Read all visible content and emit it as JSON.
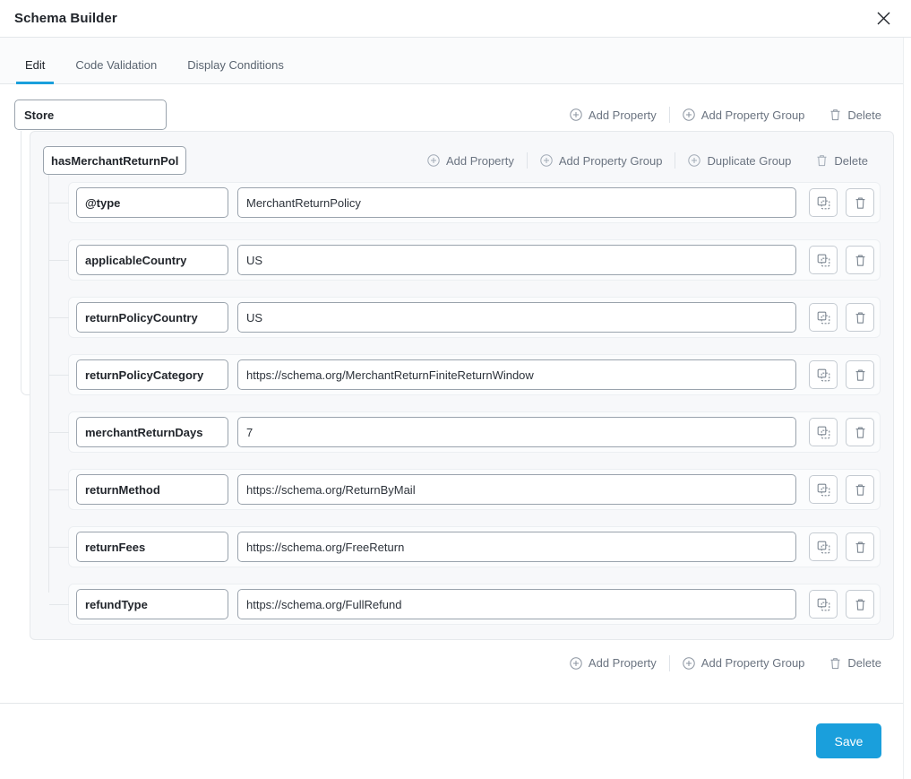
{
  "window": {
    "title": "Schema Builder",
    "close_icon": "close-icon"
  },
  "tabs": [
    {
      "label": "Edit",
      "active": true
    },
    {
      "label": "Code Validation",
      "active": false
    },
    {
      "label": "Display Conditions",
      "active": false
    }
  ],
  "root": {
    "name_value": "Store",
    "name_placeholder": "Name",
    "toolbar": {
      "add_property": "Add Property",
      "add_property_group": "Add Property Group",
      "delete": "Delete",
      "add_icon": "plus-circle-icon",
      "delete_icon": "trash-icon"
    }
  },
  "group": {
    "name_value": "hasMerchantReturnPolicy",
    "name_placeholder": "Group name",
    "toolbar": {
      "add_property": "Add Property",
      "add_property_group": "Add Property Group",
      "duplicate_group": "Duplicate Group",
      "delete": "Delete",
      "add_icon": "plus-circle-icon",
      "duplicate_icon": "plus-circle-icon",
      "delete_icon": "trash-icon"
    },
    "properties": [
      {
        "key": "@type",
        "value": "MerchantReturnPolicy"
      },
      {
        "key": "applicableCountry",
        "value": "US"
      },
      {
        "key": "returnPolicyCountry",
        "value": "US"
      },
      {
        "key": "returnPolicyCategory",
        "value": "https://schema.org/MerchantReturnFiniteReturnWindow"
      },
      {
        "key": "merchantReturnDays",
        "value": "7"
      },
      {
        "key": "returnMethod",
        "value": "https://schema.org/ReturnByMail"
      },
      {
        "key": "returnFees",
        "value": "https://schema.org/FreeReturn"
      },
      {
        "key": "refundType",
        "value": "https://schema.org/FullRefund"
      }
    ],
    "row_actions": {
      "duplicate_icon": "copy-icon",
      "delete_icon": "trash-icon"
    }
  },
  "bottom_toolbar": {
    "add_property": "Add Property",
    "add_property_group": "Add Property Group",
    "delete": "Delete",
    "add_icon": "plus-circle-icon",
    "delete_icon": "trash-icon"
  },
  "footer": {
    "save_label": "Save"
  },
  "colors": {
    "accent": "#1a9fdc",
    "text": "#21252b",
    "muted": "#6b7481",
    "border": "#e4e7ea",
    "card_bg": "#f7f8fa",
    "row_bg": "#fbfcfd"
  }
}
